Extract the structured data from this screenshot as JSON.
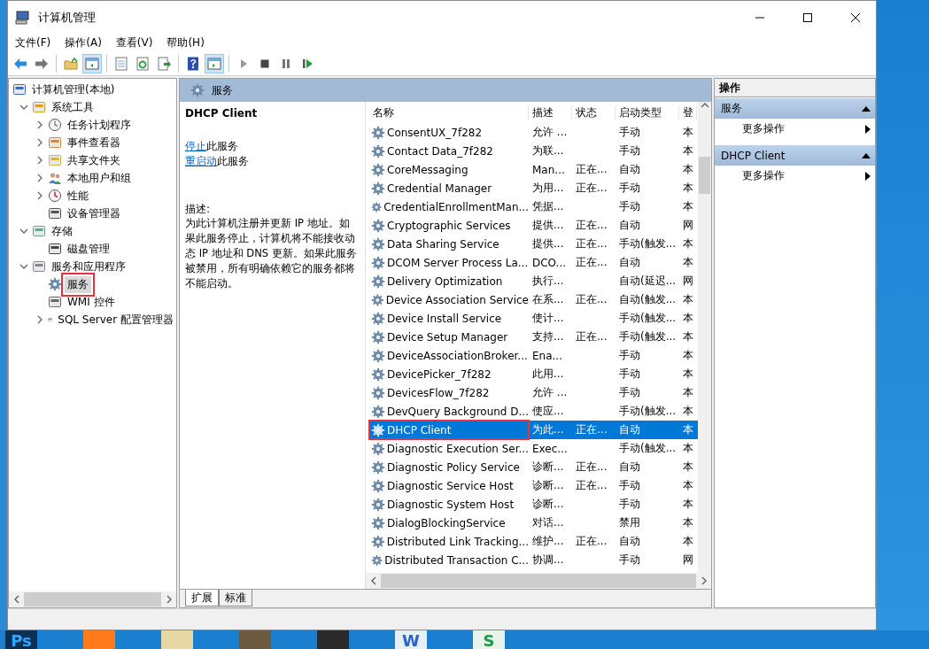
{
  "window": {
    "title": "计算机管理"
  },
  "menu": [
    "文件(F)",
    "操作(A)",
    "查看(V)",
    "帮助(H)"
  ],
  "toolbar": [
    [
      {
        "kind": "back",
        "pressed": false
      },
      {
        "kind": "forward",
        "pressed": false
      }
    ],
    [
      {
        "kind": "up",
        "pressed": false
      },
      {
        "kind": "tree",
        "pressed": true
      }
    ],
    [
      {
        "kind": "properties",
        "pressed": false
      },
      {
        "kind": "refresh",
        "pressed": false
      },
      {
        "kind": "export",
        "pressed": false
      }
    ],
    [
      {
        "kind": "help",
        "pressed": false
      },
      {
        "kind": "actionpane",
        "pressed": true
      }
    ],
    [
      {
        "kind": "play",
        "pressed": false
      },
      {
        "kind": "stop",
        "pressed": false
      },
      {
        "kind": "pause",
        "pressed": false
      },
      {
        "kind": "resume",
        "pressed": false
      }
    ]
  ],
  "tree": [
    {
      "label": "计算机管理(本地)",
      "kind": "computer",
      "selected": false,
      "annotated": false,
      "children": [
        {
          "label": "系统工具",
          "kind": "tools",
          "expanded": true,
          "selected": false,
          "annotated": false,
          "children": [
            {
              "label": "任务计划程序",
              "kind": "clock",
              "expanded": false,
              "selected": false,
              "annotated": false
            },
            {
              "label": "事件查看器",
              "kind": "event",
              "expanded": false,
              "selected": false,
              "annotated": false
            },
            {
              "label": "共享文件夹",
              "kind": "share",
              "expanded": false,
              "selected": false,
              "annotated": false
            },
            {
              "label": "本地用户和组",
              "kind": "users",
              "expanded": false,
              "selected": false,
              "annotated": false
            },
            {
              "label": "性能",
              "kind": "perf",
              "expanded": false,
              "selected": false,
              "annotated": false
            },
            {
              "label": "设备管理器",
              "kind": "device",
              "selected": false,
              "annotated": false
            }
          ]
        },
        {
          "label": "存储",
          "kind": "storage",
          "expanded": true,
          "selected": false,
          "annotated": false,
          "children": [
            {
              "label": "磁盘管理",
              "kind": "disk",
              "selected": false,
              "annotated": false
            }
          ]
        },
        {
          "label": "服务和应用程序",
          "kind": "apps",
          "expanded": true,
          "selected": false,
          "annotated": false,
          "children": [
            {
              "label": "服务",
              "kind": "services",
              "selected": true,
              "annotated": true
            },
            {
              "label": "WMI 控件",
              "kind": "wmi",
              "selected": false,
              "annotated": false
            },
            {
              "label": "SQL Server 配置管理器",
              "kind": "sql",
              "expanded": false,
              "selected": false,
              "annotated": false
            }
          ]
        }
      ]
    }
  ],
  "band": {
    "title": "服务"
  },
  "detail": {
    "title": "DHCP Client",
    "actions": [
      {
        "link": "停止",
        "text": "此服务"
      },
      {
        "link": "重启动",
        "text": "此服务"
      }
    ],
    "label": "描述:",
    "description": "为此计算机注册并更新 IP 地址。如果此服务停止，计算机将不能接收动态 IP 地址和 DNS 更新。如果此服务被禁用，所有明确依赖它的服务都将不能启动。"
  },
  "table": {
    "columns": [
      "名称",
      "描述",
      "状态",
      "启动类型",
      "登"
    ],
    "rows": [
      {
        "name": "ConsentUX_7f282",
        "description": "允许 ...",
        "status": "",
        "startup": "手动",
        "logon": "本",
        "selected": false,
        "annotated": false
      },
      {
        "name": "Contact Data_7f282",
        "description": "为联...",
        "status": "",
        "startup": "手动",
        "logon": "本",
        "selected": false,
        "annotated": false
      },
      {
        "name": "CoreMessaging",
        "description": "Man...",
        "status": "正在...",
        "startup": "自动",
        "logon": "本",
        "selected": false,
        "annotated": false
      },
      {
        "name": "Credential Manager",
        "description": "为用...",
        "status": "正在...",
        "startup": "手动",
        "logon": "本",
        "selected": false,
        "annotated": false
      },
      {
        "name": "CredentialEnrollmentMan...",
        "description": "凭据...",
        "status": "",
        "startup": "手动",
        "logon": "本",
        "selected": false,
        "annotated": false
      },
      {
        "name": "Cryptographic Services",
        "description": "提供...",
        "status": "正在...",
        "startup": "自动",
        "logon": "网",
        "selected": false,
        "annotated": false
      },
      {
        "name": "Data Sharing Service",
        "description": "提供...",
        "status": "正在...",
        "startup": "手动(触发...",
        "logon": "本",
        "selected": false,
        "annotated": false
      },
      {
        "name": "DCOM Server Process La...",
        "description": "DCO...",
        "status": "正在...",
        "startup": "自动",
        "logon": "本",
        "selected": false,
        "annotated": false
      },
      {
        "name": "Delivery Optimization",
        "description": "执行...",
        "status": "",
        "startup": "自动(延迟...",
        "logon": "网",
        "selected": false,
        "annotated": false
      },
      {
        "name": "Device Association Service",
        "description": "在系...",
        "status": "正在...",
        "startup": "自动(触发...",
        "logon": "本",
        "selected": false,
        "annotated": false
      },
      {
        "name": "Device Install Service",
        "description": "使计...",
        "status": "",
        "startup": "手动(触发...",
        "logon": "本",
        "selected": false,
        "annotated": false
      },
      {
        "name": "Device Setup Manager",
        "description": "支持...",
        "status": "正在...",
        "startup": "手动(触发...",
        "logon": "本",
        "selected": false,
        "annotated": false
      },
      {
        "name": "DeviceAssociationBroker...",
        "description": "Ena...",
        "status": "",
        "startup": "手动",
        "logon": "本",
        "selected": false,
        "annotated": false
      },
      {
        "name": "DevicePicker_7f282",
        "description": "此用...",
        "status": "",
        "startup": "手动",
        "logon": "本",
        "selected": false,
        "annotated": false
      },
      {
        "name": "DevicesFlow_7f282",
        "description": "允许 ...",
        "status": "",
        "startup": "手动",
        "logon": "本",
        "selected": false,
        "annotated": false
      },
      {
        "name": "DevQuery Background D...",
        "description": "使应...",
        "status": "",
        "startup": "手动(触发...",
        "logon": "本",
        "selected": false,
        "annotated": false
      },
      {
        "name": "DHCP Client",
        "description": "为此...",
        "status": "正在...",
        "startup": "自动",
        "logon": "本",
        "selected": true,
        "annotated": true
      },
      {
        "name": "Diagnostic Execution Ser...",
        "description": "Exec...",
        "status": "",
        "startup": "手动(触发...",
        "logon": "本",
        "selected": false,
        "annotated": false
      },
      {
        "name": "Diagnostic Policy Service",
        "description": "诊断...",
        "status": "正在...",
        "startup": "自动",
        "logon": "本",
        "selected": false,
        "annotated": false
      },
      {
        "name": "Diagnostic Service Host",
        "description": "诊断...",
        "status": "正在...",
        "startup": "手动",
        "logon": "本",
        "selected": false,
        "annotated": false
      },
      {
        "name": "Diagnostic System Host",
        "description": "诊断...",
        "status": "",
        "startup": "手动",
        "logon": "本",
        "selected": false,
        "annotated": false
      },
      {
        "name": "DialogBlockingService",
        "description": "对话...",
        "status": "",
        "startup": "禁用",
        "logon": "本",
        "selected": false,
        "annotated": false
      },
      {
        "name": "Distributed Link Tracking...",
        "description": "维护...",
        "status": "正在...",
        "startup": "自动",
        "logon": "本",
        "selected": false,
        "annotated": false
      },
      {
        "name": "Distributed Transaction C...",
        "description": "协调...",
        "status": "",
        "startup": "手动",
        "logon": "网",
        "selected": false,
        "annotated": false
      }
    ]
  },
  "view_tabs": [
    {
      "label": "扩展",
      "selected": true
    },
    {
      "label": "标准",
      "selected": false
    }
  ],
  "actions": {
    "title": "操作",
    "sections": [
      {
        "title": "服务",
        "expanded": true,
        "items": [
          "更多操作"
        ]
      },
      {
        "title": "DHCP Client",
        "expanded": true,
        "items": [
          "更多操作"
        ]
      }
    ]
  },
  "taskbar": [
    {
      "kind": "photoshop",
      "label": "Ps"
    },
    {
      "kind": "firefox"
    },
    {
      "kind": "files"
    },
    {
      "kind": "photo"
    },
    {
      "kind": "game"
    },
    {
      "kind": "writer",
      "label": "W"
    },
    {
      "kind": "sheets",
      "label": "S"
    }
  ]
}
